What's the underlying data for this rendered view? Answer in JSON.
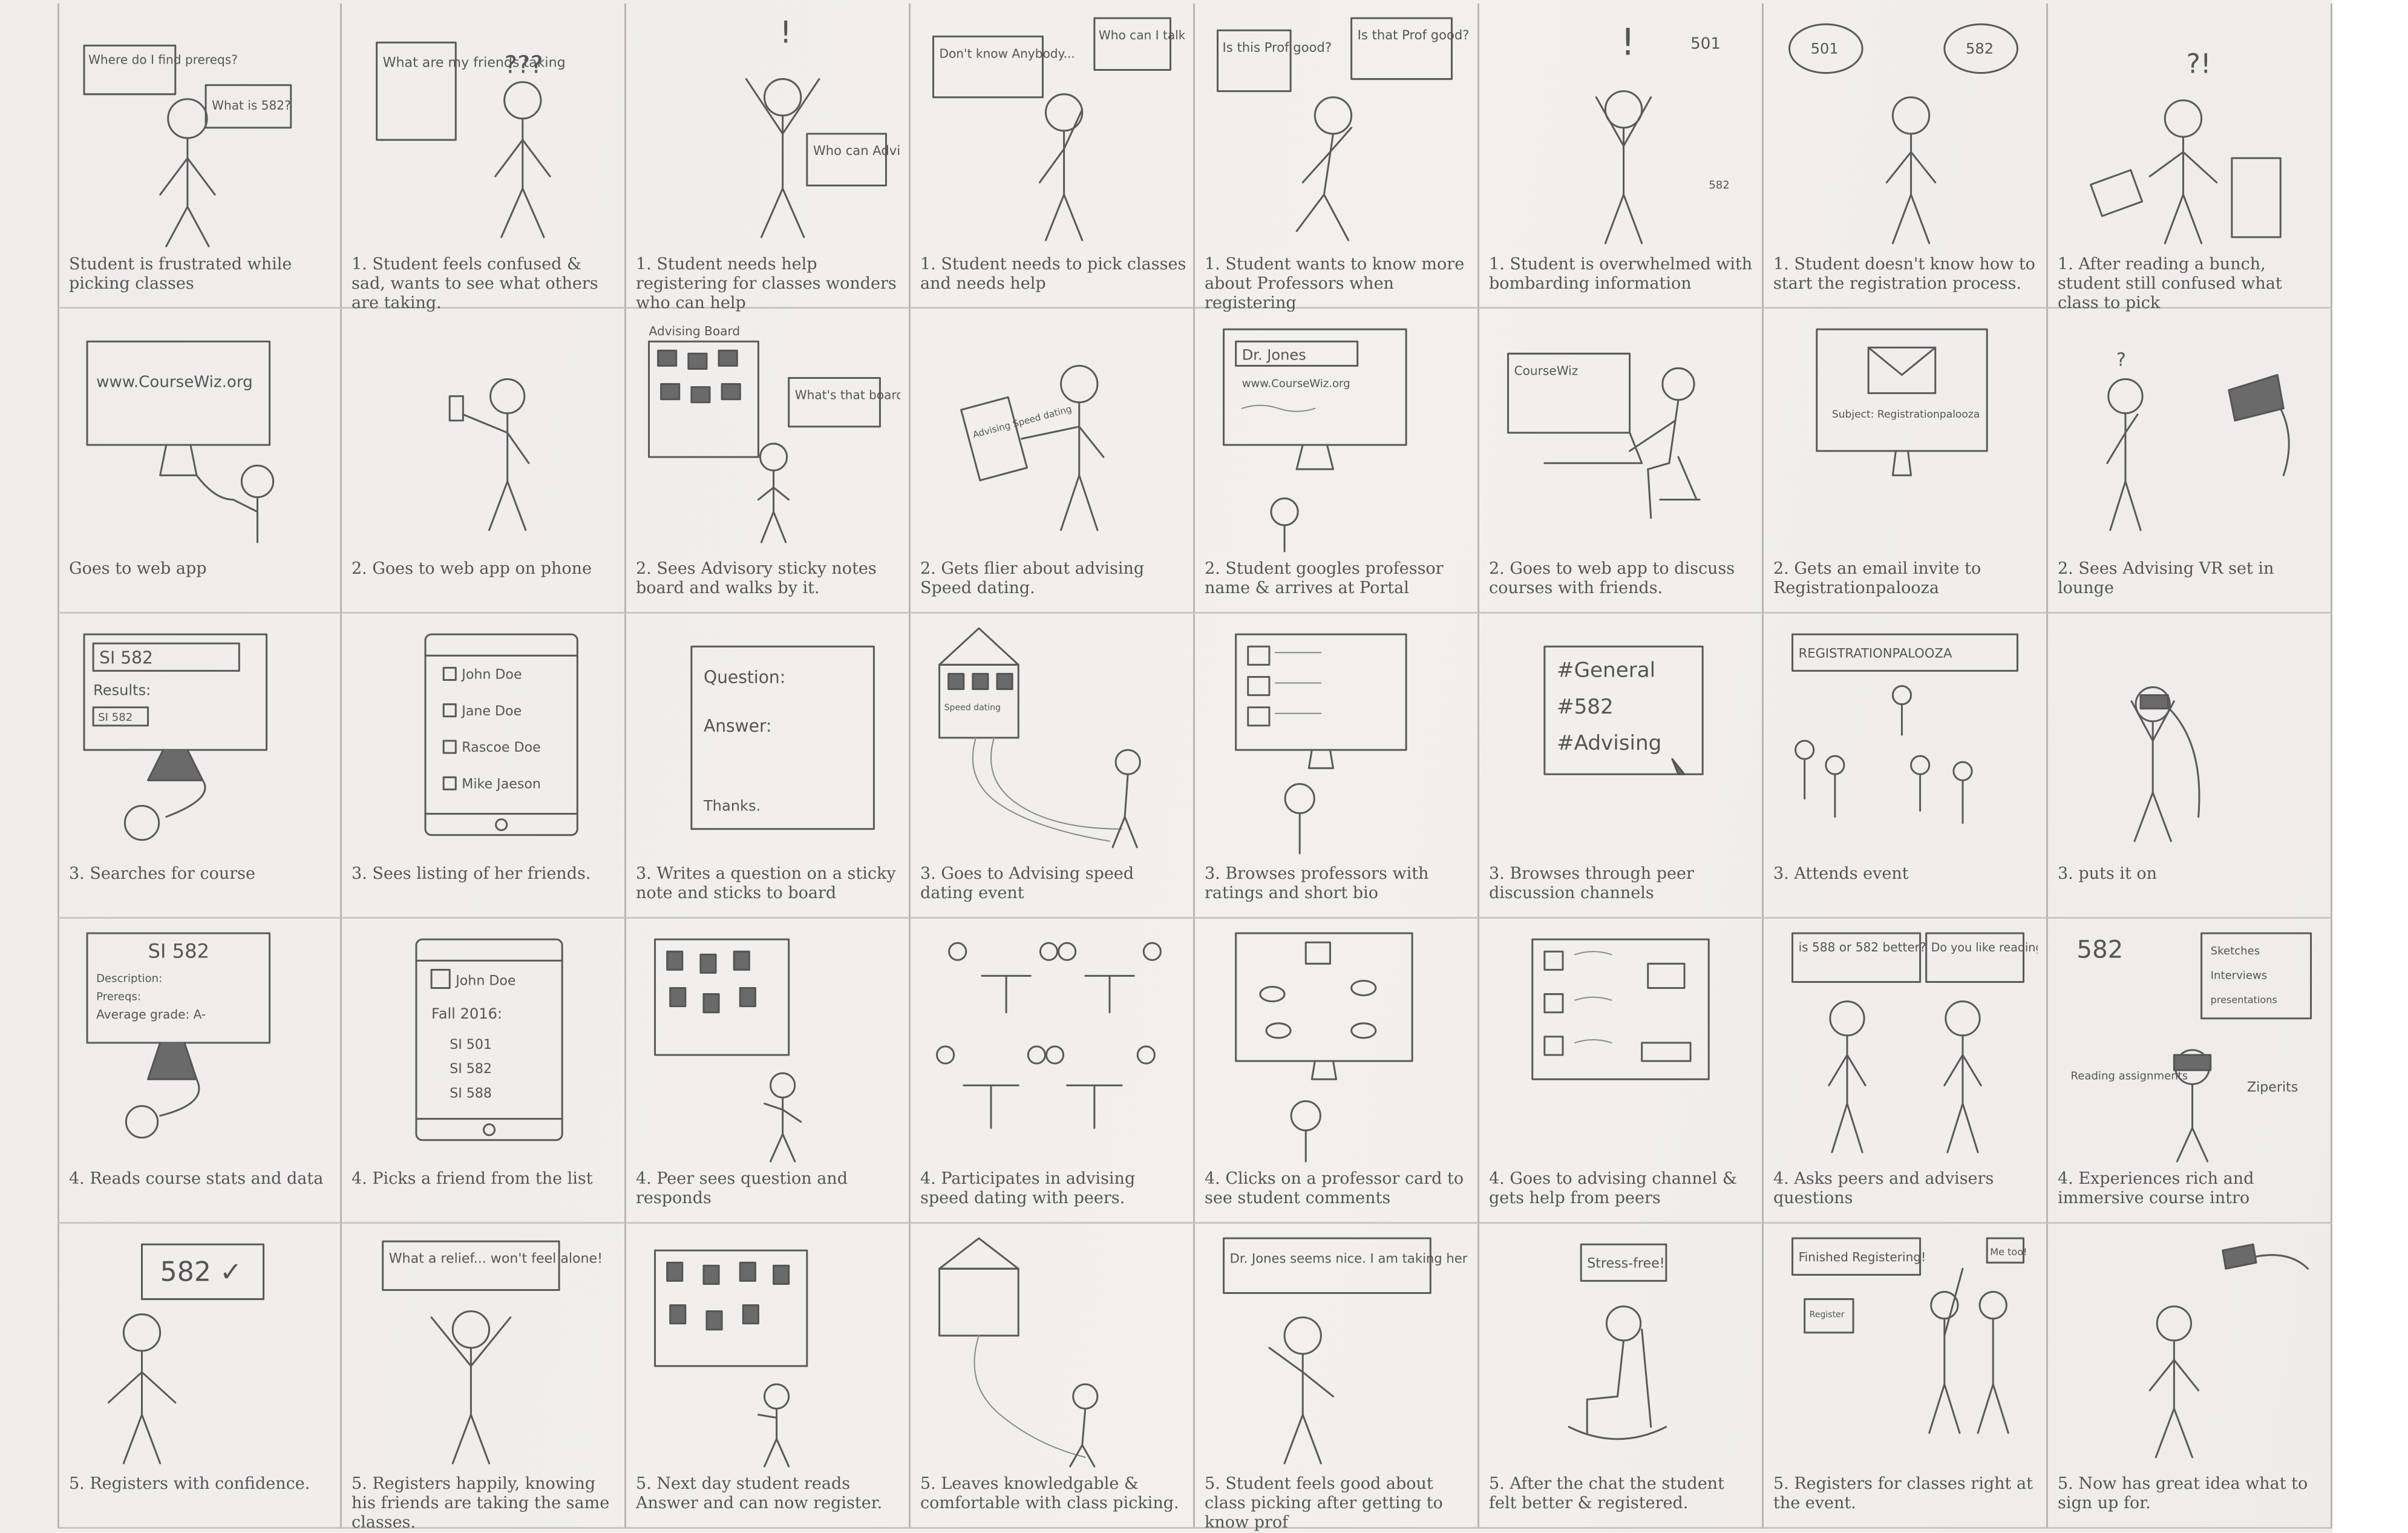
{
  "storyboard": {
    "rows": [
      {
        "panels": [
          {
            "caption": "Student is frustrated while picking classes",
            "bubbles": [
              "Where do I find prereqs?",
              "What is 582?"
            ]
          },
          {
            "caption": "1. Student feels confused & sad, wants to see what others are taking.",
            "bubbles": [
              "What are my friends taking",
              "???"
            ]
          },
          {
            "caption": "1. Student needs help registering for classes wonders who can help",
            "bubbles": [
              "!",
              "Who can Advice me"
            ]
          },
          {
            "caption": "1. Student needs to pick classes and needs help",
            "bubbles": [
              "Don't know Anybody...",
              "Who can I talk to?"
            ]
          },
          {
            "caption": "1. Student wants to know more about Professors when registering",
            "bubbles": [
              "Is this Prof good?",
              "Is that Prof good?"
            ]
          },
          {
            "caption": "1. Student is overwhelmed with bombarding information",
            "bubbles": [
              "501",
              "582"
            ]
          },
          {
            "caption": "1. Student doesn't know how to start the registration process.",
            "bubbles": [
              "501",
              "582"
            ]
          },
          {
            "caption": "1. After reading a bunch, student still confused what class to pick",
            "bubbles": [
              "?!"
            ]
          }
        ]
      },
      {
        "panels": [
          {
            "caption": "Goes to web app",
            "screen_text": "www.CourseWiz.org"
          },
          {
            "caption": "2. Goes to web app on phone"
          },
          {
            "caption": "2. Sees Advisory sticky notes board and walks by it.",
            "screen_text": "Advising Board",
            "bubbles": [
              "What's that board?"
            ]
          },
          {
            "caption": "2. Gets flier about advising Speed dating.",
            "screen_text": "Advising Speed dating"
          },
          {
            "caption": "2. Student googles professor name & arrives at Portal",
            "screen_text": "Dr. Jones",
            "url": "www.CourseWiz.org"
          },
          {
            "caption": "2. Goes to web app to discuss courses with friends.",
            "screen_text": "CourseWiz"
          },
          {
            "caption": "2. Gets an email invite to Registrationpalooza",
            "screen_text": "Subject: Registrationpalooza"
          },
          {
            "caption": "2. Sees Advising VR set in lounge"
          }
        ]
      },
      {
        "panels": [
          {
            "caption": "3. Searches for course",
            "screen_text": "SI 582",
            "results_label": "Results:",
            "result_item": "SI 582"
          },
          {
            "caption": "3. Sees listing of her friends.",
            "list": [
              "John Doe",
              "Jane Doe",
              "Rascoe Doe",
              "Mike Jaeson"
            ]
          },
          {
            "caption": "3. Writes a question on a sticky note and sticks to board",
            "note_lines": [
              "Question:",
              "Answer:",
              "Thanks."
            ]
          },
          {
            "caption": "3. Goes to Advising speed dating event",
            "screen_text": "Speed dating"
          },
          {
            "caption": "3. Browses professors with ratings and short bio"
          },
          {
            "caption": "3. Browses through peer discussion channels",
            "channels": [
              "#General",
              "#582",
              "#Advising"
            ]
          },
          {
            "caption": "3. Attends event",
            "banner": "REGISTRATIONPALOOZA"
          },
          {
            "caption": "3. puts it on"
          }
        ]
      },
      {
        "panels": [
          {
            "caption": "4. Reads course stats and data",
            "title": "SI 582",
            "lines": [
              "Description:",
              "Prereqs:",
              "Average grade: A-"
            ]
          },
          {
            "caption": "4. Picks a friend from the list",
            "profile": "John Doe",
            "term": "Fall 2016:",
            "courses": [
              "SI 501",
              "SI 582",
              "SI 588"
            ]
          },
          {
            "caption": "4. Peer sees question and responds"
          },
          {
            "caption": "4. Participates in advising speed dating with peers."
          },
          {
            "caption": "4. Clicks on a professor card to see student comments"
          },
          {
            "caption": "4. Goes to advising channel & gets help from peers"
          },
          {
            "caption": "4. Asks peers and advisers questions",
            "bubbles": [
              "is 588 or 582 better?",
              "Do you like reading?"
            ]
          },
          {
            "caption": "4. Experiences rich and immersive course intro",
            "labels": [
              "582",
              "Sketches",
              "Interviews",
              "presentations",
              "Reading assignments",
              "Ziperits"
            ]
          }
        ]
      },
      {
        "panels": [
          {
            "caption": "5. Registers with confidence.",
            "bubbles": [
              "582 ✓"
            ]
          },
          {
            "caption": "5. Registers happily, knowing his friends are taking the same classes.",
            "bubbles": [
              "What a relief... won't feel alone!"
            ]
          },
          {
            "caption": "5. Next day student reads Answer and can now register."
          },
          {
            "caption": "5. Leaves knowledgable & comfortable with class picking."
          },
          {
            "caption": "5. Student feels good about class picking after getting to know prof",
            "bubbles": [
              "Dr. Jones seems nice. I am taking her class"
            ]
          },
          {
            "caption": "5. After the chat the student felt better & registered.",
            "bubbles": [
              "Stress-free!"
            ]
          },
          {
            "caption": "5. Registers for classes right at the event.",
            "bubbles": [
              "Finished Registering!",
              "Me too!"
            ],
            "screen_text": "Register"
          },
          {
            "caption": "5. Now has great idea what to sign up for."
          }
        ]
      }
    ]
  }
}
